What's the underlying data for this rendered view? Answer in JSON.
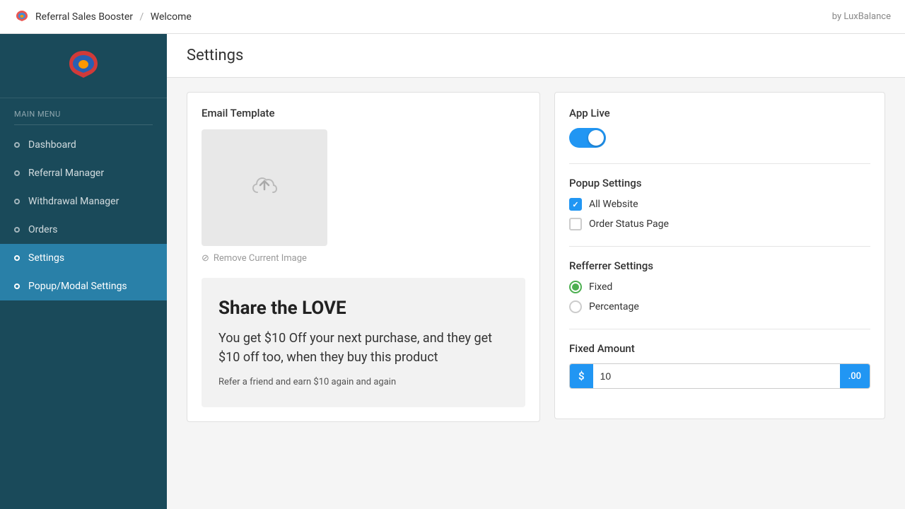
{
  "topbar": {
    "app_name": "Referral Sales Booster",
    "separator": "/",
    "page_name": "Welcome",
    "by_label": "by LuxBalance"
  },
  "sidebar": {
    "menu_label": "Main Menu",
    "items": [
      {
        "id": "dashboard",
        "label": "Dashboard",
        "active": false
      },
      {
        "id": "referral-manager",
        "label": "Referral Manager",
        "active": false
      },
      {
        "id": "withdrawal-manager",
        "label": "Withdrawal Manager",
        "active": false
      },
      {
        "id": "orders",
        "label": "Orders",
        "active": false
      },
      {
        "id": "settings",
        "label": "Settings",
        "active": true
      },
      {
        "id": "popup-modal-settings",
        "label": "Popup/Modal Settings",
        "active": false
      }
    ]
  },
  "content": {
    "page_title": "Settings",
    "left_panel": {
      "section_title": "Email Template",
      "remove_image_label": "Remove Current Image",
      "preview": {
        "title": "Share the LOVE",
        "body": "You get $10 Off your next purchase, and they get $10 off too, when they buy this product",
        "footer": "Refer a friend and earn $10 again and again"
      }
    },
    "right_panel": {
      "app_live_label": "App Live",
      "popup_settings_label": "Popup Settings",
      "popup_options": [
        {
          "label": "All Website",
          "checked": true
        },
        {
          "label": "Order Status Page",
          "checked": false
        }
      ],
      "referrer_settings_label": "Refferrer Settings",
      "referrer_options": [
        {
          "label": "Fixed",
          "selected": true
        },
        {
          "label": "Percentage",
          "selected": false
        }
      ],
      "fixed_amount_label": "Fixed Amount",
      "fixed_amount_prefix": "$",
      "fixed_amount_value": "10",
      "fixed_amount_suffix": ".00"
    }
  }
}
